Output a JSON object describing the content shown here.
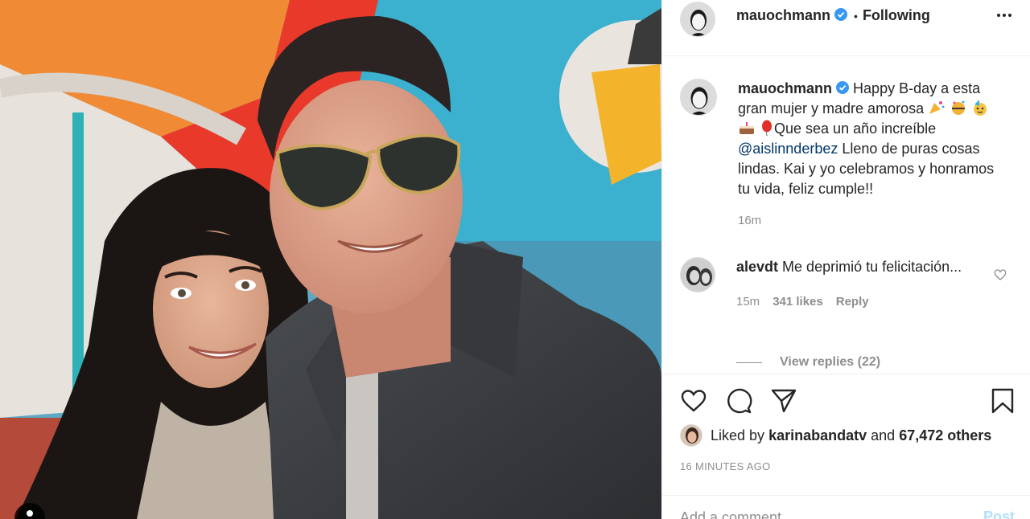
{
  "post": {
    "author": "mauochmann",
    "follow_status": "Following",
    "header_separator": "•"
  },
  "caption": {
    "username": "mauochmann",
    "text_1": "Happy B-day a esta gran mujer y madre amorosa",
    "text_2": "Que sea un año increíble",
    "mention": "@aislinnderbez",
    "text_3": "Lleno de puras cosas lindas. Kai y yo celebramos y honramos tu vida, feliz cumple!!",
    "time": "16m"
  },
  "comment": {
    "username": "alevdt",
    "text": "Me deprimió tu felicitación...",
    "time": "15m",
    "likes": "341 likes",
    "reply_label": "Reply",
    "view_replies": "View replies (22)"
  },
  "likes": {
    "prefix": "Liked by",
    "user": "karinabandatv",
    "connector": "and",
    "others": "67,472 others"
  },
  "timestamp": "16 MINUTES AGO",
  "add_comment": {
    "placeholder": "Add a comment...",
    "post_label": "Post"
  },
  "colors": {
    "verified": "#3897f0",
    "link": "#00376b",
    "muted": "#8e8e8e",
    "post_disabled": "#b2dffc"
  }
}
